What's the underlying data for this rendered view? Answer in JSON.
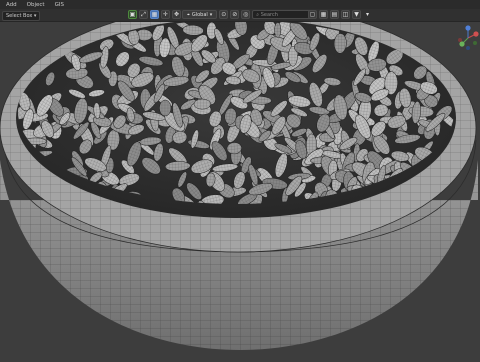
{
  "menu": {
    "items": [
      "Add",
      "Object",
      "GIS"
    ]
  },
  "toolbar": {
    "select_mode": "Select Box",
    "transform_orientation": "Global",
    "search_placeholder": "Search"
  },
  "colors": {
    "accent": "#4772b3",
    "viewport_bg": "#3d3d3d",
    "mesh_fill": "#a9a9a9",
    "wire": "#2c2c2c"
  },
  "icons": [
    "grid-icon",
    "snap-icon",
    "proportional-edit-icon",
    "overlay-icon",
    "filter-icon",
    "axis-gizmo-icon"
  ]
}
